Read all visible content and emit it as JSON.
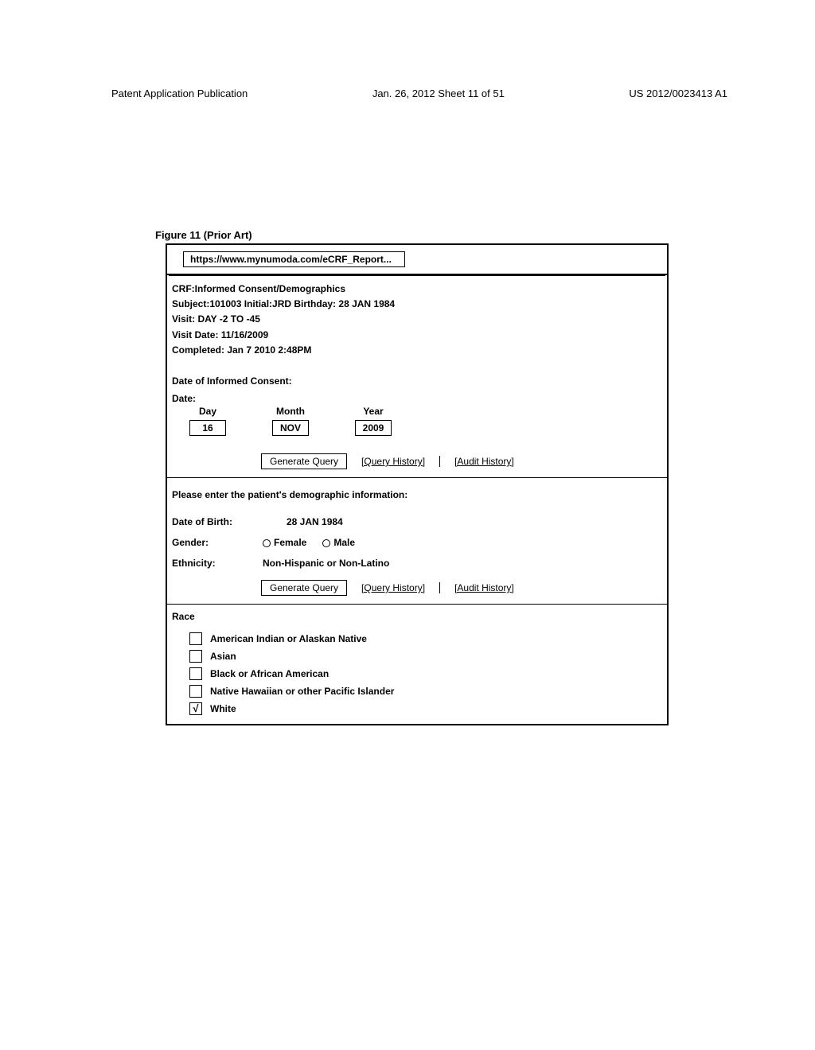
{
  "header": {
    "left": "Patent Application Publication",
    "center": "Jan. 26, 2012  Sheet 11 of 51",
    "right": "US 2012/0023413 A1"
  },
  "figure_caption": "Figure 11 (Prior Art)",
  "url": "https://www.mynumoda.com/eCRF_Report...",
  "meta": {
    "crf": "CRF:Informed Consent/Demographics",
    "subject_line": "Subject:101003  Initial:JRD   Birthday:  28 JAN 1984",
    "visit": "Visit: DAY -2 TO -45",
    "visit_date": "Visit Date: 11/16/2009",
    "completed": "Completed: Jan 7 2010  2:48PM"
  },
  "consent": {
    "label": "Date of Informed Consent:",
    "date_label": "Date:",
    "headers": {
      "day": "Day",
      "month": "Month",
      "year": "Year"
    },
    "values": {
      "day": "16",
      "month": "NOV",
      "year": "2009"
    }
  },
  "actions": {
    "generate": "Generate Query",
    "query_history": "[Query History]",
    "audit_history": "[Audit History]"
  },
  "demographics": {
    "prompt": "Please enter the patient's demographic information:",
    "dob_label": "Date of Birth:",
    "dob_value": "28 JAN 1984",
    "gender_label": "Gender:",
    "gender_female": "Female",
    "gender_male": "Male",
    "ethnicity_label": "Ethnicity:",
    "ethnicity_value": "Non-Hispanic or Non-Latino"
  },
  "race": {
    "header": "Race",
    "options": [
      {
        "label": "American Indian or Alaskan Native",
        "checked": false
      },
      {
        "label": "Asian",
        "checked": false
      },
      {
        "label": "Black or African American",
        "checked": false
      },
      {
        "label": "Native Hawaiian or other Pacific Islander",
        "checked": false
      },
      {
        "label": "White",
        "checked": true
      }
    ]
  }
}
